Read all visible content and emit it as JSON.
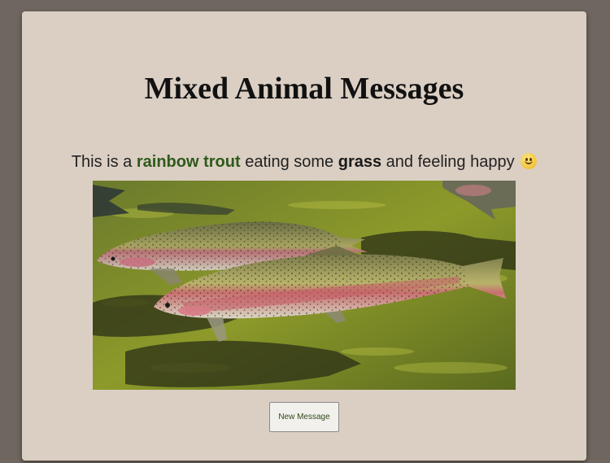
{
  "page": {
    "title": "Mixed Animal Messages"
  },
  "message": {
    "prefix": "This is a",
    "animal": "rainbow trout",
    "middle": "eating some",
    "food": "grass",
    "suffix": "and feeling happy",
    "emoji": "slightly-smiling-face-icon"
  },
  "image": {
    "subject": "rainbow trout photo"
  },
  "button": {
    "label": "New Message"
  },
  "colors": {
    "background": "#6f675f",
    "card": "#dbcfc4",
    "animal_highlight": "#2f5a1a"
  }
}
